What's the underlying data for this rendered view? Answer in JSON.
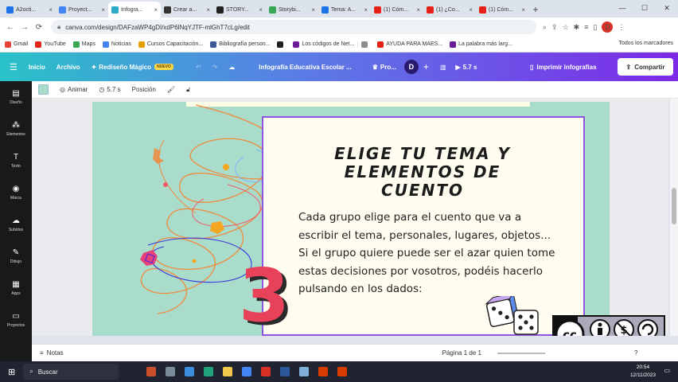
{
  "browser": {
    "tabs": [
      {
        "label": "A2octi...",
        "color": "#1a73e8"
      },
      {
        "label": "Proyect...",
        "color": "#4285f4"
      },
      {
        "label": "Infogra...",
        "color": "#2aa9c9",
        "active": true
      },
      {
        "label": "Crear a...",
        "color": "#333333"
      },
      {
        "label": "STORY...",
        "color": "#222222"
      },
      {
        "label": "Storybi...",
        "color": "#34a853"
      },
      {
        "label": "Tema: A...",
        "color": "#1a73e8"
      },
      {
        "label": "(1) Cóm...",
        "color": "#e62117"
      },
      {
        "label": "(1) ¿Co...",
        "color": "#e62117"
      },
      {
        "label": "(1) Cóm...",
        "color": "#e62117"
      }
    ],
    "url": "canva.com/design/DAFzaWP4gDI/xdP6lNqYJTF-mlGhT7cLg/edit",
    "profile_initial": "D"
  },
  "bookmarks": {
    "items": [
      {
        "label": "Gmail",
        "color": "#ea4335"
      },
      {
        "label": "YouTube",
        "color": "#e62117"
      },
      {
        "label": "Maps",
        "color": "#34a853"
      },
      {
        "label": "Noticias",
        "color": "#4285f4"
      },
      {
        "label": "Cursos Capacitación...",
        "color": "#e8a000"
      },
      {
        "label": "Bibliografía person...",
        "color": "#3c5a99"
      },
      {
        "label": "",
        "color": "#222222"
      },
      {
        "label": "Los códigos de Net...",
        "color": "#6a1b9a"
      },
      {
        "label": "",
        "color": "#8e8e8e"
      },
      {
        "label": "AYUDA PARA MAES...",
        "color": "#e62117"
      },
      {
        "label": "La palabra más larg...",
        "color": "#6a1b9a"
      }
    ],
    "all_bookmarks": "Todos los marcadores"
  },
  "canva_header": {
    "home": "Inicio",
    "file": "Archivo",
    "magic": "Rediseño Mágico",
    "magic_badge": "NUEVO",
    "doc_title": "Infografía Educativa Escolar ...",
    "pro": "Pro...",
    "user_initial": "D",
    "duration": "5.7 s",
    "print": "Imprimir infografías",
    "share": "Compartir"
  },
  "sidebar": {
    "items": [
      {
        "label": "Diseño",
        "icon": "▤"
      },
      {
        "label": "Elementos",
        "icon": "⁂"
      },
      {
        "label": "Texto",
        "icon": "T"
      },
      {
        "label": "Marca",
        "icon": "◉"
      },
      {
        "label": "Subidos",
        "icon": "☁"
      },
      {
        "label": "Dibujo",
        "icon": "✎"
      },
      {
        "label": "Apps",
        "icon": "▦"
      },
      {
        "label": "Proyectos",
        "icon": "▭"
      }
    ]
  },
  "toolbar": {
    "color": "#a9dccb",
    "animate": "Animar",
    "timing": "5.7 s",
    "position": "Posición"
  },
  "canvas": {
    "title_lines": [
      "ELIGE TU TEMA Y",
      "ELEMENTOS DE",
      "CUENTO"
    ],
    "paragraph1": "Cada grupo elige para el cuento que va a escribir el tema, personales, lugares, objetos...",
    "paragraph2": "Si el grupo quiere puede ser el azar quien tome estas decisiones por vosotros, podéis hacerlo pulsando en los dados:",
    "step_number": "3",
    "license": [
      "BY",
      "NC",
      "SA"
    ]
  },
  "footer": {
    "notes": "Notas",
    "page": "Página 1 de 1"
  },
  "taskbar": {
    "search": "Buscar",
    "time": "20:54",
    "date": "12/11/2023"
  }
}
